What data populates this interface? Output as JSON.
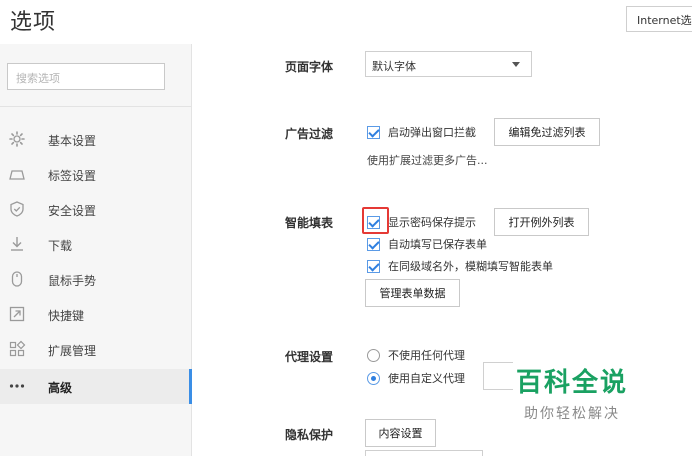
{
  "header": {
    "title": "选项",
    "ie_button_label": "Internet选项"
  },
  "sidebar": {
    "search_placeholder": "搜索选项",
    "items": [
      {
        "label": "基本设置",
        "icon": "gear-icon"
      },
      {
        "label": "标签设置",
        "icon": "tab-icon"
      },
      {
        "label": "安全设置",
        "icon": "shield-icon"
      },
      {
        "label": "下载",
        "icon": "download-icon"
      },
      {
        "label": "鼠标手势",
        "icon": "mouse-icon"
      },
      {
        "label": "快捷键",
        "icon": "shortcut-icon"
      },
      {
        "label": "扩展管理",
        "icon": "extensions-icon"
      },
      {
        "label": "高级",
        "icon": "more-dots-icon",
        "active": true
      }
    ]
  },
  "main": {
    "font": {
      "label": "页面字体",
      "selected": "默认字体"
    },
    "adblock": {
      "label": "广告过滤",
      "popup_block": "启动弹出窗口拦截",
      "popup_block_checked": true,
      "edit_button": "编辑免过滤列表",
      "helper": "使用扩展过滤更多广告..."
    },
    "autofill": {
      "label": "智能填表",
      "show_password_prompt": "显示密码保存提示",
      "show_password_prompt_checked": true,
      "exceptions_button": "打开例外列表",
      "auto_fill_saved": "自动填写已保存表单",
      "auto_fill_saved_checked": true,
      "fuzzy_fill": "在同级域名外，模糊填写智能表单",
      "fuzzy_fill_checked": true,
      "manage_button": "管理表单数据"
    },
    "proxy": {
      "label": "代理设置",
      "no_proxy": "不使用任何代理",
      "custom_proxy": "使用自定义代理",
      "selected": "custom_proxy"
    },
    "privacy": {
      "label": "隐私保护",
      "content_button": "内容设置"
    }
  },
  "watermark": {
    "main": "百科全说",
    "sub": "助你轻松解决"
  },
  "colors": {
    "accent": "#2f7fe0",
    "highlight": "#e53935",
    "watermark": "#1aa162"
  }
}
